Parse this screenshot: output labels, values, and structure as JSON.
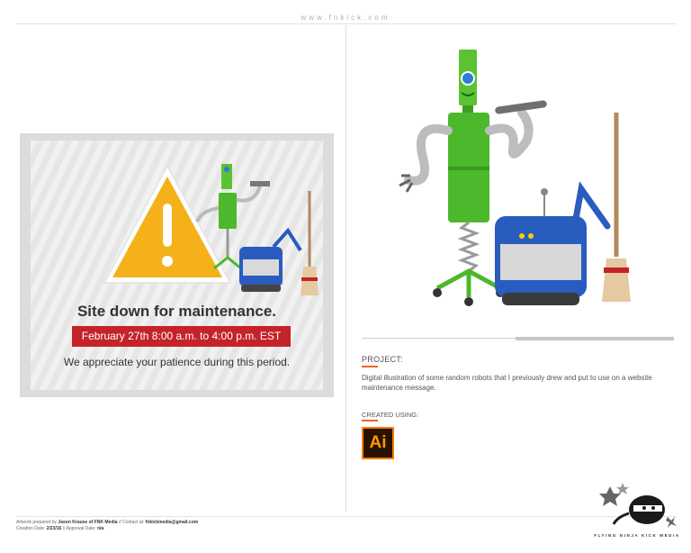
{
  "header": {
    "url": "www.fnkick.com"
  },
  "mockup": {
    "title": "Site down for maintenance.",
    "date_banner": "February 27th 8:00 a.m. to 4:00 p.m. EST",
    "subtitle": "We appreciate your patience during this period."
  },
  "project": {
    "label": "PROJECT:",
    "description": "Digital illustration of some random robots that I previously drew and put to use on a website maintenance message.",
    "created_label": "CREATED USING:",
    "tool_icon": "Ai"
  },
  "footer": {
    "prefix1": "Artwork prepared by ",
    "author": "Jason Krause of FNK Media",
    "contact_prefix": " // Contact at: ",
    "email": "fnkickmedia@gmail.com",
    "created_prefix": "Creation Date: ",
    "created_date": "2/23/16",
    "approval_prefix": " // Approval Date: ",
    "approval_date": "n/a"
  },
  "brand": {
    "name": "FLYING NINJA KICK MEDIA"
  },
  "colors": {
    "accent": "#f26522",
    "banner_red": "#c4232a",
    "robot_green": "#4cb82c",
    "robot_blue": "#2a5bbf"
  }
}
